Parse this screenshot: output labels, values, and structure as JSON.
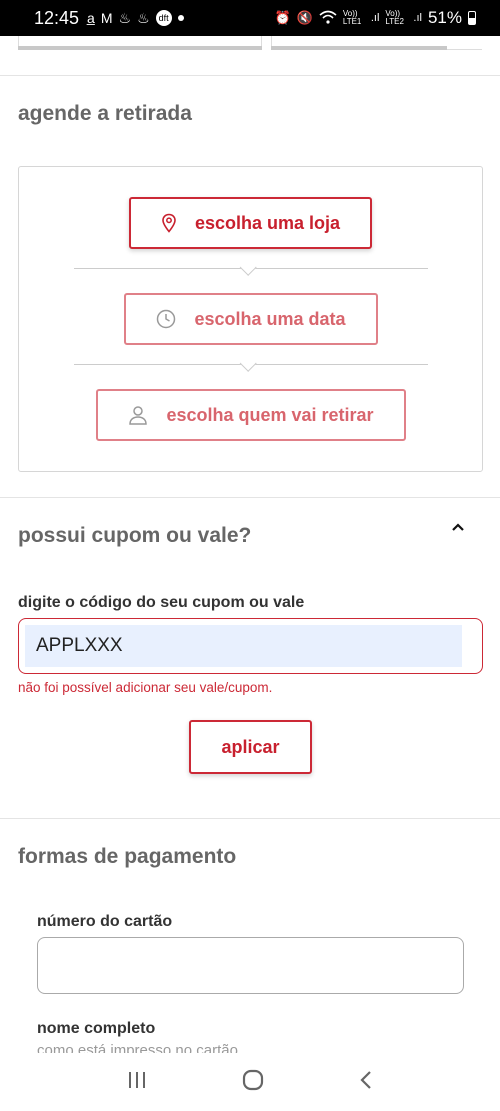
{
  "status_bar": {
    "time": "12:45",
    "left_icons": [
      "amazon-icon",
      "gmail-icon",
      "flame-icon",
      "flame-icon",
      "dft-icon",
      "dot"
    ],
    "right_icons": [
      "alarm-icon",
      "mute-icon",
      "wifi-icon",
      "volte-lte1-icon",
      "volte-lte2-icon"
    ],
    "lte1": "Vo)) LTE1",
    "lte2": "Vo)) LTE2",
    "battery": "51%"
  },
  "pickup": {
    "title": "agende a retirada",
    "choose_store": "escolha uma loja",
    "choose_date": "escolha uma data",
    "choose_person": "escolha quem vai retirar"
  },
  "coupon": {
    "title": "possui cupom ou vale?",
    "field_label": "digite o código do seu cupom ou vale",
    "value": "APPLXXX",
    "error": "não foi possível adicionar seu vale/cupom.",
    "apply_label": "aplicar"
  },
  "payment": {
    "title": "formas de pagamento",
    "card_number_label": "número do cartão",
    "card_number_value": "",
    "full_name_label": "nome completo",
    "full_name_hint": "como está impresso no cartão"
  },
  "colors": {
    "brand_red": "#cc2936",
    "muted_red": "#e08088",
    "autofill_bg": "#e8f0fe"
  }
}
